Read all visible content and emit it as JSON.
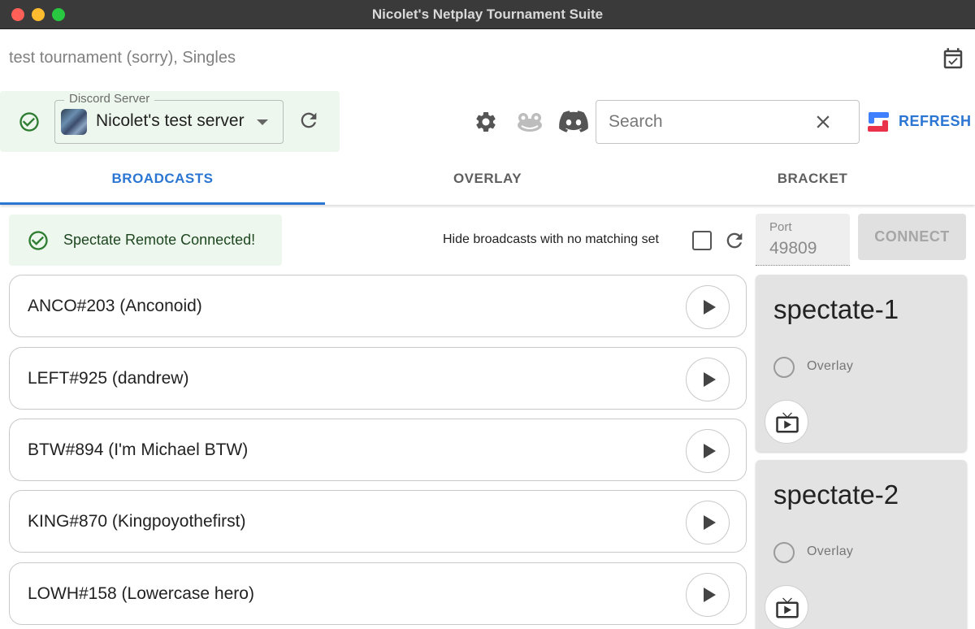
{
  "window": {
    "title": "Nicolet's Netplay Tournament Suite"
  },
  "tournament": {
    "name": "test tournament (sorry), Singles"
  },
  "discord_server": {
    "legend": "Discord Server",
    "name": "Nicolet's test server"
  },
  "search": {
    "placeholder": "Search",
    "value": ""
  },
  "refresh": {
    "label": "REFRESH"
  },
  "tabs": [
    {
      "label": "BROADCASTS",
      "active": true
    },
    {
      "label": "OVERLAY",
      "active": false
    },
    {
      "label": "BRACKET",
      "active": false
    }
  ],
  "alert": {
    "text": "Spectate Remote Connected!"
  },
  "broadcast_filter": {
    "label": "Hide broadcasts with no matching set",
    "checked": false
  },
  "port": {
    "label": "Port",
    "value": "49809"
  },
  "connect": {
    "label": "CONNECT"
  },
  "broadcasts": [
    {
      "name": "ANCO#203 (Anconoid)"
    },
    {
      "name": "LEFT#925 (dandrew)"
    },
    {
      "name": "BTW#894 (I'm Michael BTW)"
    },
    {
      "name": "KING#870 (Kingpoyothefirst)"
    },
    {
      "name": "LOWH#158 (Lowercase hero)"
    }
  ],
  "spectates": [
    {
      "name": "spectate-1",
      "overlay_label": "Overlay"
    },
    {
      "name": "spectate-2",
      "overlay_label": "Overlay"
    }
  ],
  "colors": {
    "accent": "#2b76d2",
    "success_bg": "#edf7ed",
    "success_fg": "#2e7d32",
    "refresh_red": "#e8334a"
  },
  "icons": [
    "calendar-check-icon",
    "check-circle-icon",
    "refresh-icon",
    "gear-icon",
    "frog-icon",
    "discord-icon",
    "close-icon",
    "start-gg-logo",
    "play-icon",
    "live-tv-icon"
  ]
}
